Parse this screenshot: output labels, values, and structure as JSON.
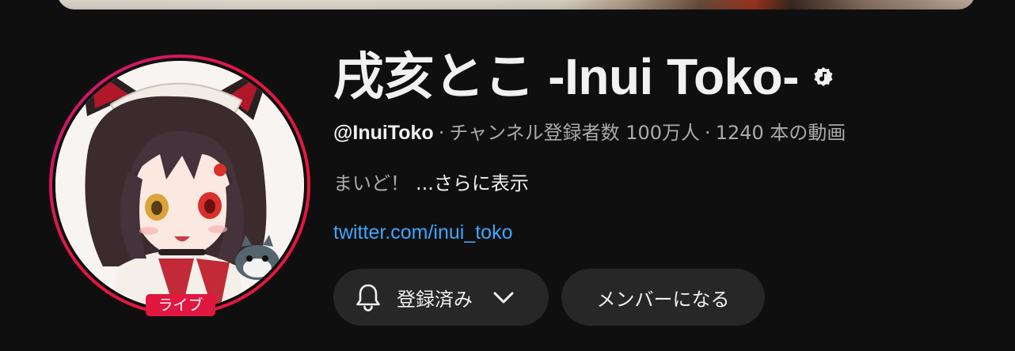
{
  "channel": {
    "title": "戌亥とこ -Inui Toko-",
    "handle": "@InuiToko",
    "separator": "·",
    "subscribers": "チャンネル登録者数 100万人",
    "videos": "1240 本の動画",
    "description": "まいど！",
    "more_label": "...さらに表示",
    "link": "twitter.com/inui_toko",
    "live_badge": "ライブ"
  },
  "buttons": {
    "subscribe_label": "登録済み",
    "member_label": "メンバーになる"
  },
  "icons": {
    "verified": "music-note-badge-icon",
    "bell": "bell-icon",
    "chevron": "chevron-down-icon"
  },
  "colors": {
    "background": "#0f0f0f",
    "text_primary": "#f1f1f1",
    "text_secondary": "#aaaaaa",
    "link": "#3ea6ff",
    "button_bg": "#272727",
    "live_red": "#e0173f"
  }
}
